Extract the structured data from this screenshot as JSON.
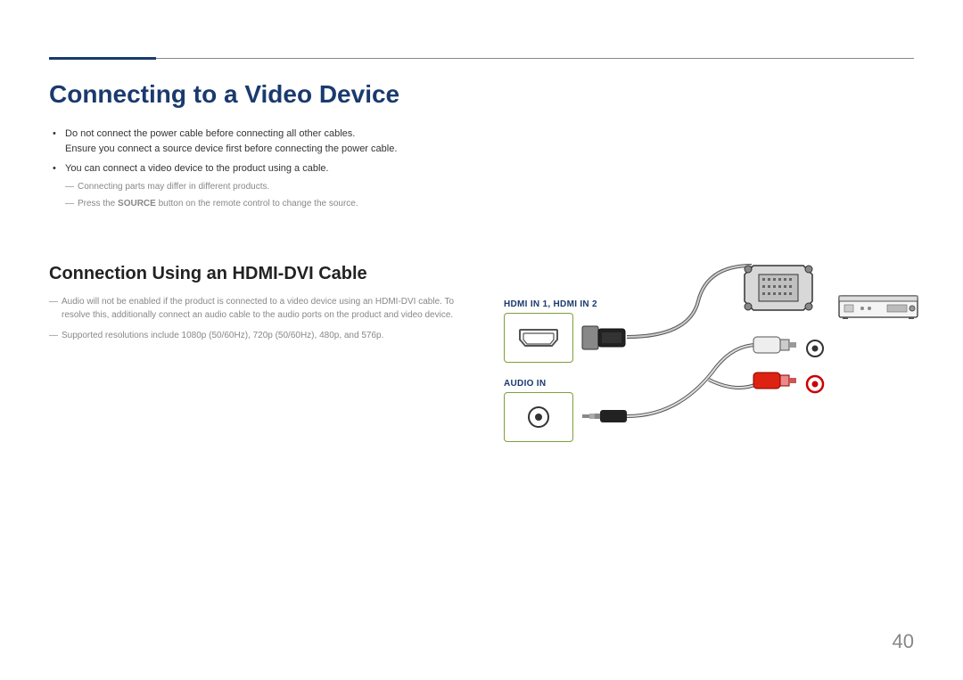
{
  "page_number": "40",
  "heading": "Connecting to a Video Device",
  "bullets": [
    {
      "lines": [
        "Do not connect the power cable before connecting all other cables.",
        "Ensure you connect a source device first before connecting the power cable."
      ]
    },
    {
      "lines": [
        "You can connect a video device to the product using a cable."
      ],
      "notes": [
        {
          "text_before": "Connecting parts may differ in different products.",
          "bold": "",
          "text_after": ""
        },
        {
          "text_before": "Press the ",
          "bold": "SOURCE",
          "text_after": " button on the remote control to change the source."
        }
      ]
    }
  ],
  "sub_heading": "Connection Using an HDMI-DVI Cable",
  "sub_notes": [
    {
      "text_before": "Audio will not be enabled if the product is connected to a video device using an HDMI-DVI cable. To resolve this, additionally connect an audio cable to the audio ports on the product and video device.",
      "bold": "",
      "text_after": ""
    },
    {
      "text_before": "Supported resolutions include 1080p (50/60Hz), 720p (50/60Hz), 480p, and 576p.",
      "bold": "",
      "text_after": ""
    }
  ],
  "diagram": {
    "hdmi_label": "HDMI IN 1, HDMI IN 2",
    "audio_label": "AUDIO IN"
  }
}
